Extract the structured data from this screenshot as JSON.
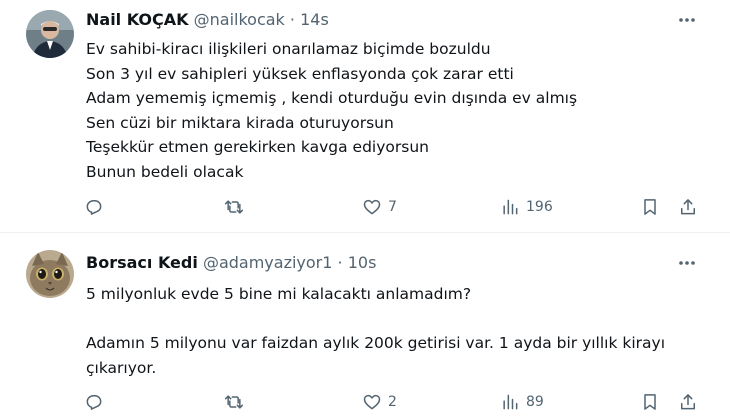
{
  "tweets": [
    {
      "name": "Nail KOÇAK",
      "handle": "@nailkocak",
      "separator": "·",
      "time": "14s",
      "text": "Ev sahibi-kiracı ilişkileri onarılamaz biçimde bozuldu\nSon 3 yıl ev sahipleri yüksek enflasyonda çok zarar etti\nAdam yememiş içmemiş , kendi oturduğu evin dışında ev almış\nSen cüzi bir miktara kirada oturuyorsun\nTeşekkür etmen gerekirken kavga ediyorsun\nBunun bedeli olacak",
      "replies": "",
      "retweets": "",
      "likes": "7",
      "views": "196"
    },
    {
      "name": "Borsacı Kedi",
      "handle": "@adamyaziyor1",
      "separator": "·",
      "time": "10s",
      "text": "5 milyonluk evde 5 bine mi kalacaktı anlamadım?\n\nAdamın 5 milyonu var faizdan aylık 200k getirisi var. 1 ayda bir yıllık kirayı çıkarıyor.",
      "replies": "",
      "retweets": "",
      "likes": "2",
      "views": "89"
    }
  ],
  "colors": {
    "icon": "#536471",
    "divider": "#eff3f4",
    "text": "#0f1419"
  }
}
